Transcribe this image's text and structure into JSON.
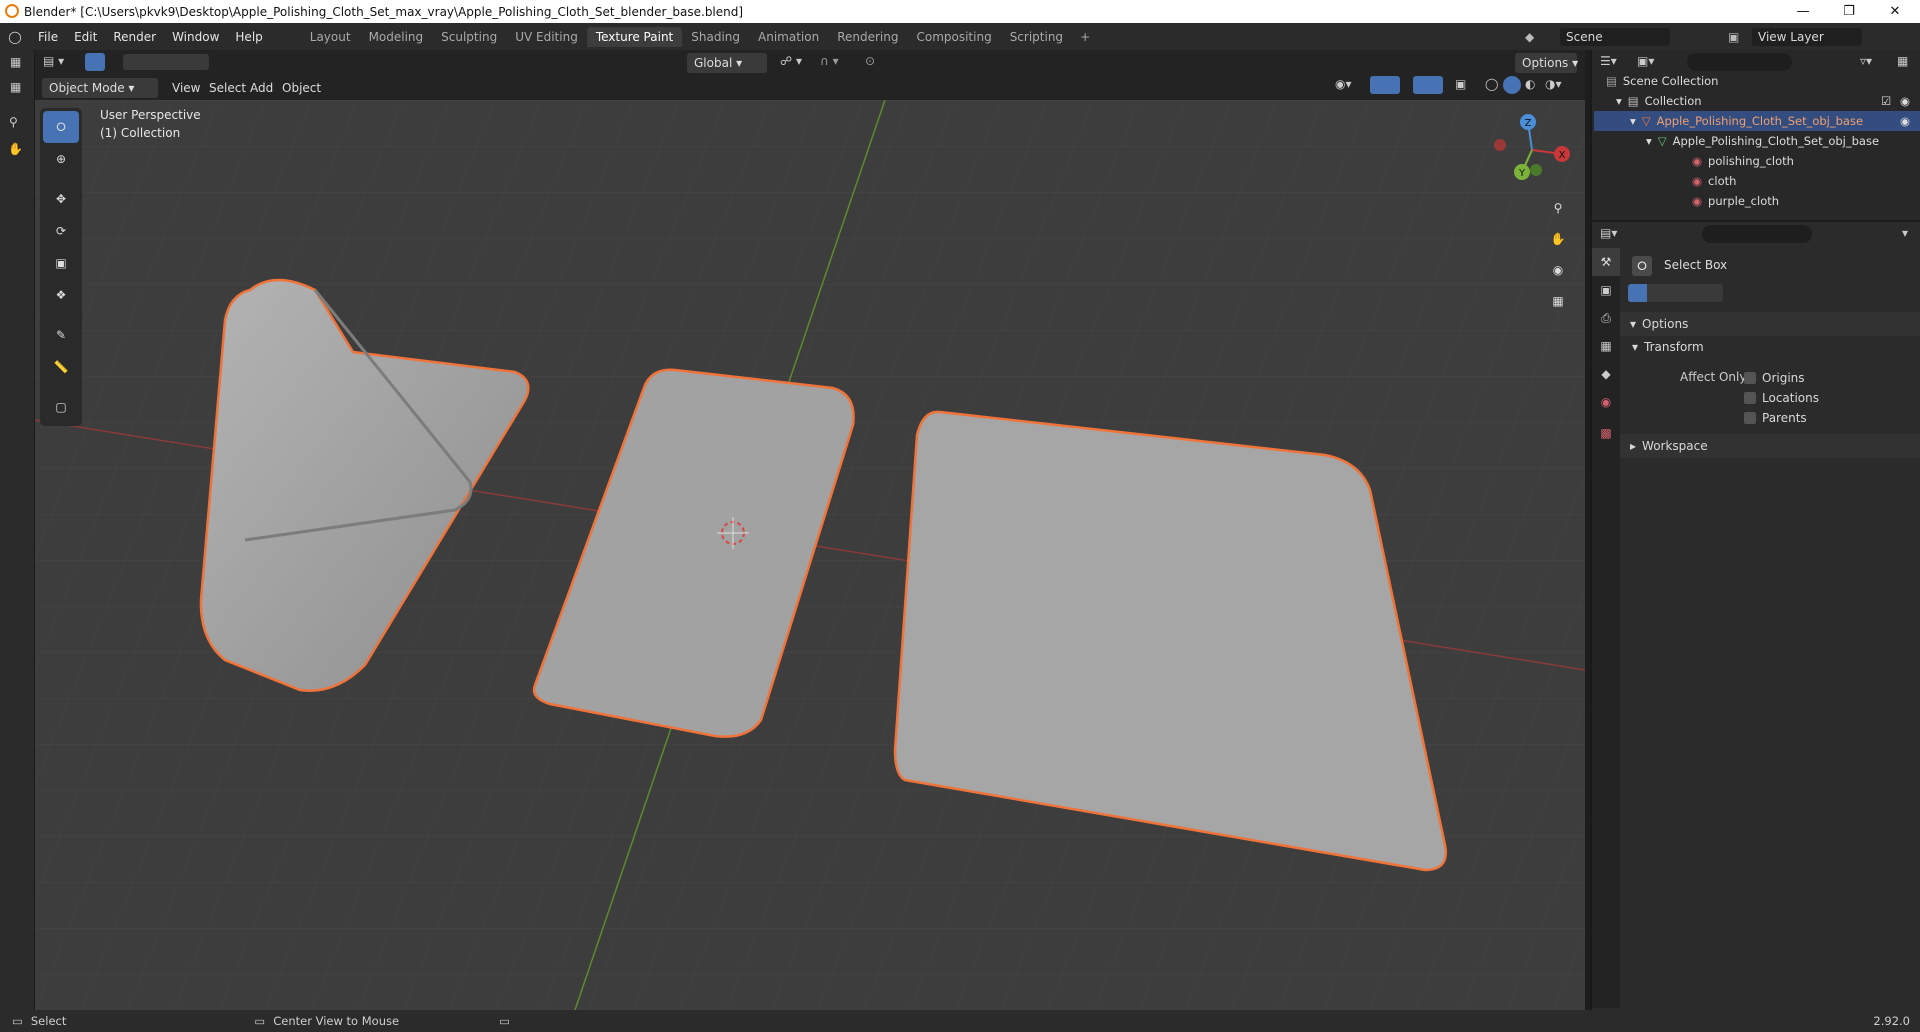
{
  "title": "Blender* [C:\\Users\\pkvk9\\Desktop\\Apple_Polishing_Cloth_Set_max_vray\\Apple_Polishing_Cloth_Set_blender_base.blend]",
  "menus": [
    "File",
    "Edit",
    "Render",
    "Window",
    "Help"
  ],
  "workspaces": [
    "Layout",
    "Modeling",
    "Sculpting",
    "UV Editing",
    "Texture Paint",
    "Shading",
    "Animation",
    "Rendering",
    "Compositing",
    "Scripting"
  ],
  "active_workspace": "Texture Paint",
  "scene": "Scene",
  "view_layer": "View Layer",
  "header": {
    "mode": "Object Mode",
    "view": "View",
    "select": "Select",
    "add": "Add",
    "object": "Object",
    "orientation": "Global",
    "options": "Options"
  },
  "viewport": {
    "perspective": "User Perspective",
    "collection": "(1) Collection",
    "gizmo_axes": [
      "Z",
      "X",
      "Y"
    ]
  },
  "outliner": {
    "root": "Scene Collection",
    "collection": "Collection",
    "object": "Apple_Polishing_Cloth_Set_obj_base",
    "mesh": "Apple_Polishing_Cloth_Set_obj_base",
    "materials": [
      "polishing_cloth",
      "cloth",
      "purple_cloth"
    ]
  },
  "properties": {
    "tool_name": "Select Box",
    "options_label": "Options",
    "transform_label": "Transform",
    "affect_only_label": "Affect Only",
    "affect_options": [
      "Origins",
      "Locations",
      "Parents"
    ],
    "workspace_label": "Workspace"
  },
  "statusbar": {
    "select": "Select",
    "center_view": "Center View to Mouse",
    "version": "2.92.0"
  },
  "colors": {
    "accent": "#4772b3",
    "selection_outline": "#f0733a",
    "active_object": "#e8773b",
    "x_axis": "#c8383a",
    "y_axis": "#7bb33a",
    "z_axis": "#4a90d9"
  }
}
